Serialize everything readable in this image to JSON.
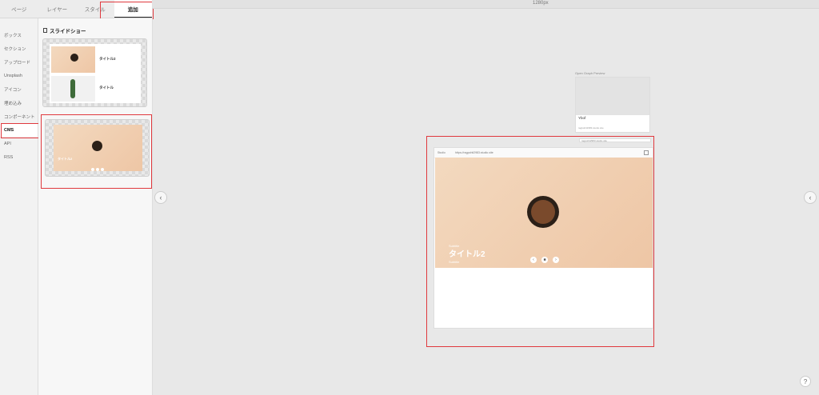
{
  "tabs": [
    "ページ",
    "レイヤー",
    "スタイル",
    "追加"
  ],
  "sidebar": {
    "items": [
      {
        "label": "ボックス"
      },
      {
        "label": "セクション"
      },
      {
        "label": "アップロード"
      },
      {
        "label": "Unsplash"
      },
      {
        "label": "アイコン"
      },
      {
        "label": "埋め込み"
      },
      {
        "label": "コンポーネント"
      },
      {
        "label": "CMS"
      },
      {
        "label": "API"
      },
      {
        "label": "RSS"
      }
    ]
  },
  "panel": {
    "title": "スライドショー",
    "template1": {
      "items": [
        {
          "title": "タイトル2"
        },
        {
          "title": "タイトル"
        }
      ]
    },
    "template2": {
      "title": "タイトル2"
    }
  },
  "canvas": {
    "ruler_label": "1280px",
    "og": {
      "label": "Open Graph Preview",
      "title": "Ybof",
      "url": "ragkohit2983.studio.site",
      "sub": "ragpohit2983.studio.site"
    },
    "browser": {
      "site": "Studio",
      "url": "https://ragpohit2983.studio.site"
    },
    "hero": {
      "small": "Subtitle",
      "title": "タイトル2",
      "sub": "Subtitle"
    }
  },
  "help": "?",
  "icons": {
    "collapse_left": "chevron-left-icon",
    "collapse_right": "chevron-left-icon",
    "doc": "slideshow-icon"
  },
  "colors": {
    "highlight": "#e0393e",
    "hero_peach": "#eec6a5"
  }
}
